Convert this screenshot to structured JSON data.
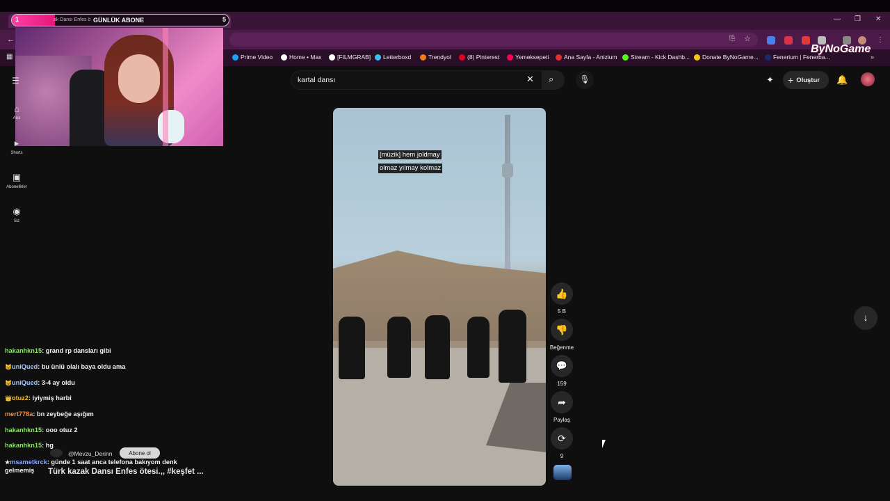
{
  "overlay": {
    "goal_start": "1",
    "goal_end": "5",
    "goal_progress": 0.2,
    "goal_label": "GÜNLÜK ABONE",
    "tab_fragment": "ak Dansı Enfes ö"
  },
  "bookmarks": [
    {
      "label": "Prime Video",
      "color": "#1da1f2"
    },
    {
      "label": "Home • Max",
      "color": "#ffffff"
    },
    {
      "label": "[FILMGRAB]",
      "color": "#ffffff"
    },
    {
      "label": "Letterboxd",
      "color": "#40bcf4"
    },
    {
      "label": "Trendyol",
      "color": "#f27a1a"
    },
    {
      "label": "(8) Pinterest",
      "color": "#e60023"
    },
    {
      "label": "Yemeksepeti",
      "color": "#fa0050"
    },
    {
      "label": "Ana Sayfa - Anizium",
      "color": "#e02f2f"
    },
    {
      "label": "Stream - Kick Dashb...",
      "color": "#53fc18"
    },
    {
      "label": "Donate ByNoGame...",
      "color": "#f5c518"
    },
    {
      "label": "Fenerium | Fenerba...",
      "color": "#1b2a6b"
    }
  ],
  "logo": "ByNoGame",
  "search": {
    "value": "kartal dansı"
  },
  "header": {
    "create_label": "Oluştur"
  },
  "sidebar": [
    {
      "label": "Ana",
      "icon": "home-icon"
    },
    {
      "label": "Shorts",
      "icon": "shorts-icon"
    },
    {
      "label": "Abonelikler",
      "icon": "subscriptions-icon"
    },
    {
      "label": "Siz",
      "icon": "you-icon"
    }
  ],
  "video": {
    "caption_line1": "[müzik] hem joldmay",
    "caption_line2": "olmaz yılmay kolmaz",
    "channel": "@Mevzu_Derinn",
    "subscribe_label": "Abone ol",
    "title": "Türk kazak Dansı Enfes ötesi.,, #keşfet ..."
  },
  "actions": {
    "like_count": "5 B",
    "dislike_label": "Beğenme",
    "comment_count": "159",
    "share_label": "Paylaş",
    "remix_count": "9"
  },
  "chat": [
    {
      "user": "hakanhkn15",
      "msg": "grand rp dansları gibi",
      "color": "#8fe36b",
      "badge": ""
    },
    {
      "user": "uniQued",
      "msg": "bu ünlü olalı baya oldu ama",
      "color": "#a9c8ff",
      "badge": "🐱"
    },
    {
      "user": "uniQued",
      "msg": "3-4 ay oldu",
      "color": "#a9c8ff",
      "badge": "🐱"
    },
    {
      "user": "otuz2",
      "msg": "iyiymiş harbi",
      "color": "#f4c430",
      "badge": "👑"
    },
    {
      "user": "mert778a",
      "msg": "bn zeybeğe aşığım",
      "color": "#ff8c3a",
      "badge": ""
    },
    {
      "user": "hakanhkn15",
      "msg": "ooo otuz 2",
      "color": "#8fe36b",
      "badge": ""
    },
    {
      "user": "hakanhkn15",
      "msg": "hg",
      "color": "#8fe36b",
      "badge": ""
    },
    {
      "user": "msametkrck",
      "msg": "günde 1 saat anca telefona bakıyom denk gelmemiş",
      "color": "#8aa8ff",
      "badge": "★"
    }
  ]
}
